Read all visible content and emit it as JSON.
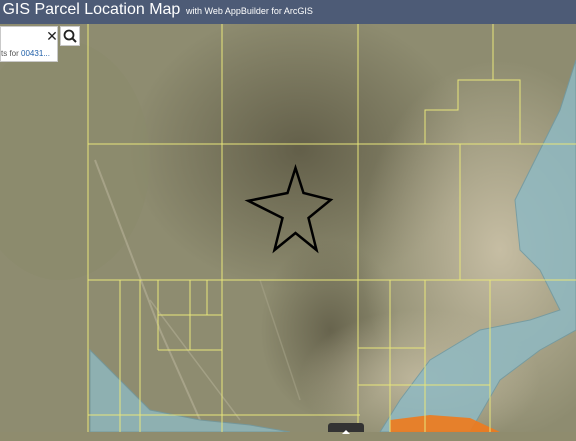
{
  "header": {
    "title": "y GIS Parcel Location Map",
    "subtitle": "with Web AppBuilder for ArcGIS"
  },
  "search": {
    "clear_icon": "close-icon",
    "search_icon": "search-icon",
    "suggestion_prefix": "ts for ",
    "suggestion_term": "00431..."
  },
  "map": {
    "marker_icon": "star-outline-icon",
    "parcel_line_color": "#e8e67a",
    "water_color": "#8fb9c2",
    "highlight_color": "#f07a1c",
    "marker_color": "#000000"
  },
  "attribution": {
    "toggle_icon": "chevron-up-icon"
  }
}
